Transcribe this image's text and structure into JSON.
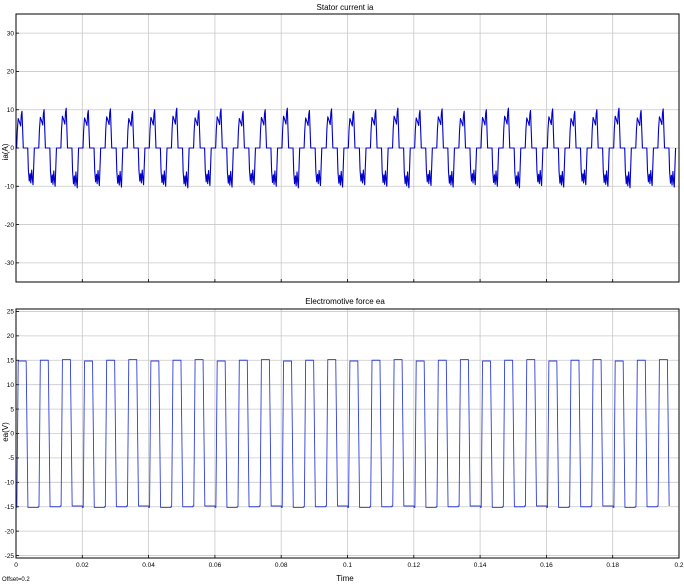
{
  "figure": {
    "offset_label": "Offset=0.2",
    "xlabel": "Time"
  },
  "colors": {
    "background": "#ffffff",
    "grid": "#c8c8c8",
    "axes": "#000000",
    "series_current": "#0000cc",
    "series_emf": "#2e3edb"
  },
  "chart_data": [
    {
      "type": "line",
      "title": "Stator current ia",
      "ylabel": "ia(A)",
      "xlabel": "",
      "xlim": [
        0,
        0.2
      ],
      "ylim": [
        -35,
        35
      ],
      "yticks": [
        -30,
        -20,
        -10,
        0,
        10,
        20,
        30
      ],
      "xticks": [
        0,
        0.02,
        0.04,
        0.06,
        0.08,
        0.1,
        0.12,
        0.14,
        0.16,
        0.18,
        0.2
      ],
      "grid": true,
      "series": [
        {
          "waveform": "six-step current, zero dwell between half-cycles",
          "period_s": 0.00667,
          "positive_peak": 10,
          "negative_peak": -10,
          "first_plateau": 8,
          "notch": 6,
          "plateau_level": 0
        }
      ]
    },
    {
      "type": "line",
      "title": "Electromotive force ea",
      "ylabel": "ea(V)",
      "xlabel": "Time",
      "xlim": [
        0,
        0.2
      ],
      "ylim": [
        -25.5,
        25.5
      ],
      "yticks": [
        -25,
        -20,
        -15,
        -10,
        -5,
        0,
        5,
        10,
        15,
        20,
        25
      ],
      "xticks": [
        0,
        0.02,
        0.04,
        0.06,
        0.08,
        0.1,
        0.12,
        0.14,
        0.16,
        0.18,
        0.2
      ],
      "grid": true,
      "series": [
        {
          "waveform": "trapezoidal back-EMF",
          "period_s": 0.00667,
          "high": 15,
          "low": -15
        }
      ]
    }
  ]
}
